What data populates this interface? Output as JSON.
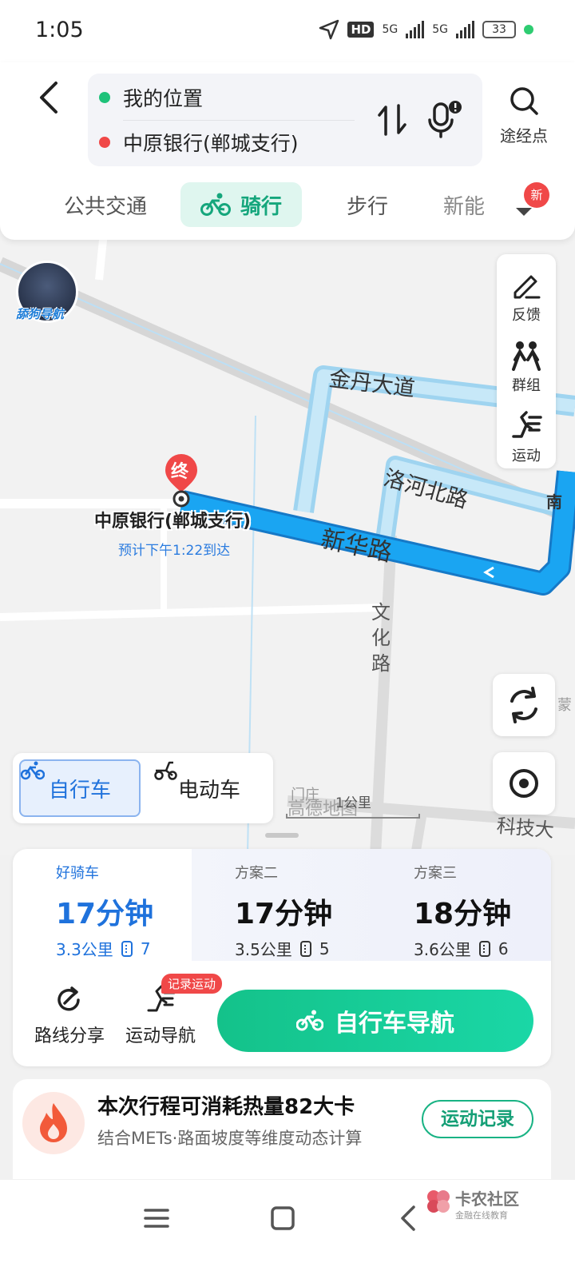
{
  "status": {
    "time": "1:05",
    "hd": "HD",
    "net1": "5G",
    "net2": "5G",
    "battery": "33"
  },
  "route": {
    "origin": "我的位置",
    "destination": "中原银行(郸城支行)",
    "waypoint_label": "途经点"
  },
  "modes": [
    {
      "label": "公共交通"
    },
    {
      "label": "骑行"
    },
    {
      "label": "步行"
    },
    {
      "label": "新能"
    }
  ],
  "new_badge": "新",
  "map": {
    "avatar_label": "舔狗导航",
    "roads": [
      "金丹大道",
      "洛河北路",
      "新华路",
      "文化路",
      "科技大"
    ],
    "partial_labels": [
      "南",
      "门庄",
      "蒙"
    ],
    "dest_marker": "终",
    "dest_name": "中原银行(郸城支行)",
    "dest_eta": "预计下午1:22到达",
    "scale": "1公里",
    "brand": "高德地图"
  },
  "tools": [
    {
      "label": "反馈",
      "icon": "pencil-icon"
    },
    {
      "label": "群组",
      "icon": "group-icon"
    },
    {
      "label": "运动",
      "icon": "running-icon"
    }
  ],
  "vehicle": {
    "bike": "自行车",
    "ebike": "电动车"
  },
  "plans": [
    {
      "name": "好骑车",
      "time": "17分钟",
      "dist": "3.3公里",
      "lights": "7"
    },
    {
      "name": "方案二",
      "time": "17分钟",
      "dist": "3.5公里",
      "lights": "5"
    },
    {
      "name": "方案三",
      "time": "18分钟",
      "dist": "3.6公里",
      "lights": "6"
    }
  ],
  "actions": {
    "share": "路线分享",
    "sport": "运动导航",
    "rec_badge": "记录运动"
  },
  "nav_button": "自行车导航",
  "calorie": {
    "title": "本次行程可消耗热量82大卡",
    "subtitle": "结合METs·路面坡度等维度动态计算",
    "button": "运动记录"
  },
  "watermark": {
    "text": "卡农社区",
    "sub": "金融在线教育"
  },
  "colors": {
    "accent": "#15a67c",
    "route_blue": "#1aa5f2",
    "selected_blue": "#1f72dc",
    "dest_red": "#f04848"
  }
}
